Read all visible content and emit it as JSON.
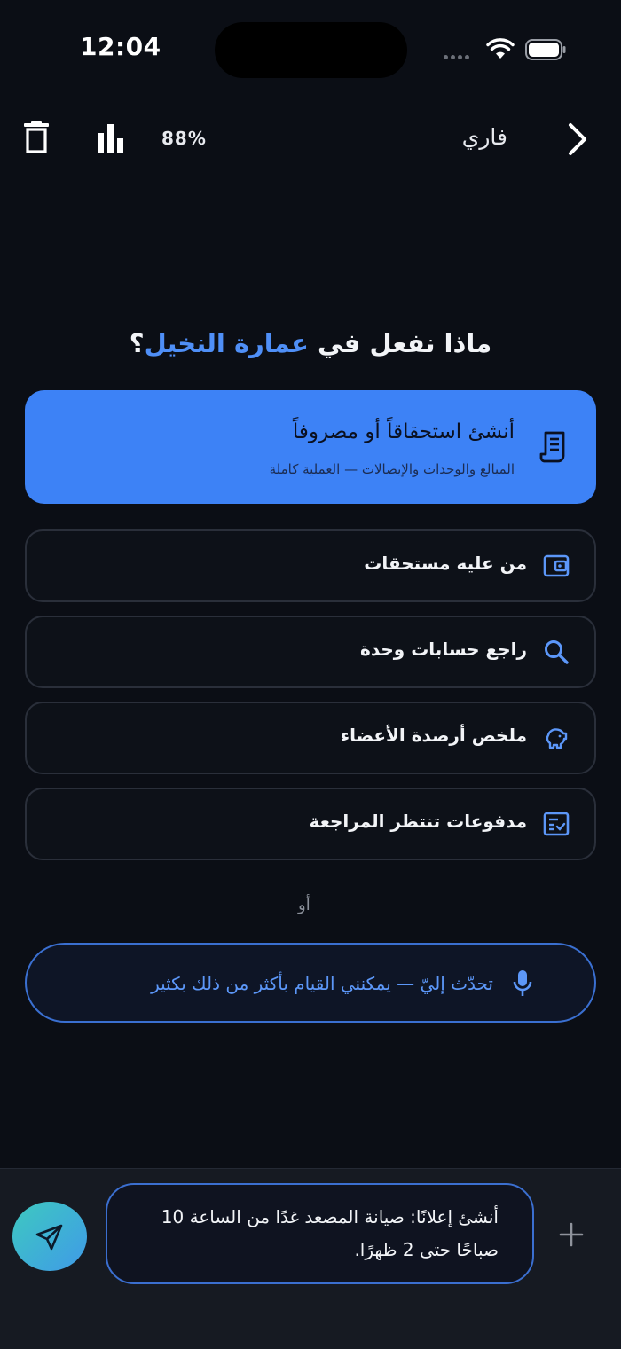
{
  "status_bar": {
    "time": "12:04"
  },
  "top_bar": {
    "percent": "88%",
    "user_name": "فاري"
  },
  "heading": {
    "prefix": "ماذا نفعل في ",
    "building": "عمارة النخيل",
    "suffix": "؟"
  },
  "primary_action": {
    "title": "أنشئ استحقاقاً أو مصروفاً",
    "subtitle": "المبالغ والوحدات والإيصالات — العملية كاملة",
    "icon": "receipt-icon"
  },
  "actions": [
    {
      "label": "من عليه مستحقات",
      "icon": "wallet-icon"
    },
    {
      "label": "راجع حسابات وحدة",
      "icon": "search-icon"
    },
    {
      "label": "ملخص أرصدة الأعضاء",
      "icon": "piggy-bank-icon"
    },
    {
      "label": "مدفوعات تنتظر المراجعة",
      "icon": "checklist-icon"
    }
  ],
  "divider": {
    "text": "أو"
  },
  "talk": {
    "label": "تحدّث إليّ — يمكنني القيام بأكثر من ذلك بكثير",
    "icon": "microphone-icon"
  },
  "composer": {
    "value": "أنشئ إعلانًا: صيانة المصعد غدًا من الساعة 10 صباحًا حتى 2 ظهرًا.",
    "send_icon": "send-icon",
    "plus_icon": "plus-icon"
  },
  "colors": {
    "background": "#0b0e15",
    "accent": "#3d82f6",
    "highlight": "#4f8ff7",
    "send_gradient_start": "#3ec9c0",
    "send_gradient_end": "#3f9ae8"
  }
}
